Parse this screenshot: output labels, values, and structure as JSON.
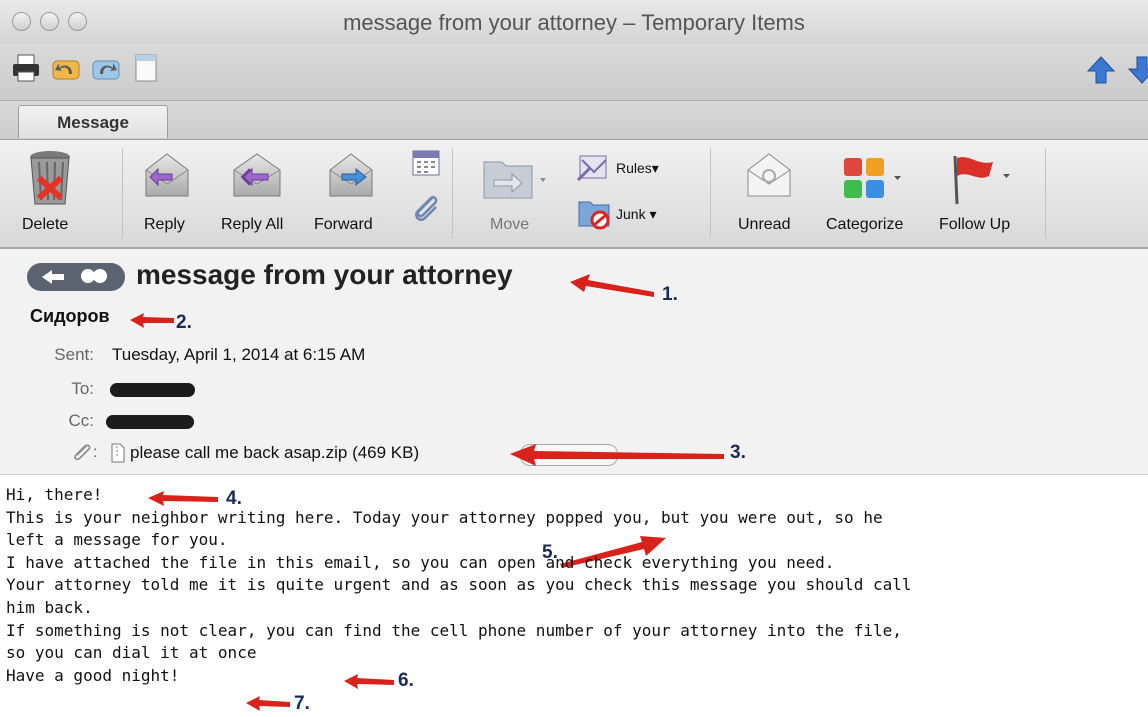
{
  "window": {
    "title": "message from your attorney – Temporary Items"
  },
  "toolbar_icons": [
    "print-icon",
    "undo-icon",
    "redo-icon",
    "note-icon",
    "up-arrow-icon",
    "down-arrow-icon"
  ],
  "tabs": [
    {
      "label": "Message"
    }
  ],
  "ribbon": {
    "delete": "Delete",
    "reply": "Reply",
    "reply_all": "Reply All",
    "forward": "Forward",
    "move": "Move",
    "rules": "Rules",
    "junk": "Junk",
    "unread": "Unread",
    "categorize": "Categorize",
    "follow_up": "Follow Up"
  },
  "message": {
    "subject": "message from your attorney",
    "sender": "Сидоров",
    "sent_label": "Sent:",
    "sent_value": "Tuesday, April 1, 2014 at 6:15 AM",
    "to_label": "To:",
    "cc_label": "Cc:",
    "attachment": "please call me back asap.zip (469 KB)"
  },
  "annotations": [
    "1.",
    "2.",
    "3.",
    "4.",
    "5.",
    "6.",
    "7."
  ],
  "body_lines": [
    "Hi, there!",
    "This is your neighbor writing here. Today your attorney popped you, but you were out, so he",
    "left a message for you.",
    "I have attached the file in this email, so you can open and check everything you need.",
    "Your attorney told me it is quite urgent and as soon as you check this message you should call",
    "him back.",
    "If something is not clear, you can find the cell phone number of your attorney into the file,",
    "so you can dial it at once",
    "Have a good night!"
  ],
  "colors": {
    "arrow_red": "#d8221b",
    "annotation_navy": "#1b2b58",
    "flag_red": "#d9312a",
    "arrow_blue": "#3a78d4"
  }
}
